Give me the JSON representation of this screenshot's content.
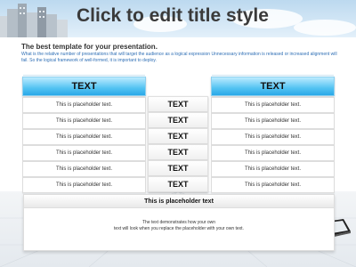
{
  "title": "Click to edit title style",
  "subtitle": "The best template for your presentation.",
  "description": "What is the relative number of presentations that will target the audience as a logical expression Unnecessary information is released or increased alignment will fail. So the logical framework of well-formed, it is important to deploy.",
  "left_header": "TEXT",
  "right_header": "TEXT",
  "rows": [
    {
      "left": "This is placeholder text.",
      "mid": "TEXT",
      "right": "This is placeholder text."
    },
    {
      "left": "This is placeholder text.",
      "mid": "TEXT",
      "right": "This is placeholder text."
    },
    {
      "left": "This is placeholder text.",
      "mid": "TEXT",
      "right": "This is placeholder text."
    },
    {
      "left": "This is placeholder text.",
      "mid": "TEXT",
      "right": "This is placeholder text."
    },
    {
      "left": "This is placeholder text.",
      "mid": "TEXT",
      "right": "This is placeholder text."
    },
    {
      "left": "This is placeholder text.",
      "mid": "TEXT",
      "right": "This is placeholder text."
    }
  ],
  "bottom": {
    "heading": "This is placeholder text",
    "body_line1": "The text demonstrates how your own",
    "body_line2": "text will look when you replace the placeholder with your own text."
  },
  "colors": {
    "header_blue": "#2aa8e8",
    "title_gray": "#3a3a3a",
    "description_blue": "#2f6fb5"
  },
  "icons": [
    "city-skyline-icon",
    "tablet-device-icon"
  ]
}
